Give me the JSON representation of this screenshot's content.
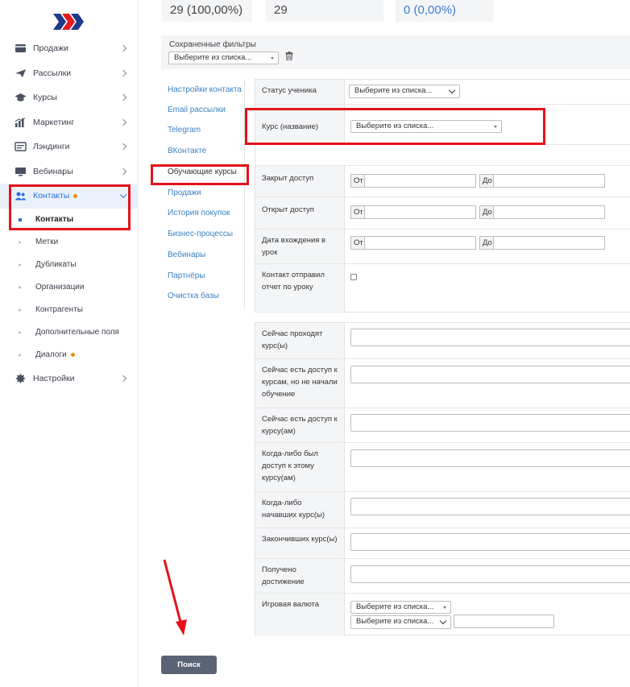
{
  "sidebar": {
    "logo_icon": "brand-chevrons-icon",
    "items": [
      {
        "label": "Продажи",
        "icon": "wallet-icon"
      },
      {
        "label": "Рассылки",
        "icon": "paper-plane-icon"
      },
      {
        "label": "Курсы",
        "icon": "graduation-cap-icon"
      },
      {
        "label": "Маркетинг",
        "icon": "bar-chart-icon"
      },
      {
        "label": "Лэндинги",
        "icon": "landing-page-icon"
      },
      {
        "label": "Вебинары",
        "icon": "monitor-icon"
      },
      {
        "label": "Контакты",
        "icon": "users-icon"
      }
    ],
    "contacts_sub": [
      {
        "label": "Контакты"
      },
      {
        "label": "Метки"
      },
      {
        "label": "Дубликаты"
      },
      {
        "label": "Организации"
      },
      {
        "label": "Контрагенты"
      },
      {
        "label": "Дополнительные поля"
      },
      {
        "label": "Диалоги"
      }
    ],
    "settings": {
      "label": "Настройки",
      "icon": "gear-icon"
    }
  },
  "stats": {
    "a": "29 (100,00%)",
    "b": "29",
    "c": "0 (0,00%)"
  },
  "saved_filters": {
    "label": "Сохраненные фильтры",
    "select_value": "Выберите из списка..."
  },
  "section_menu": [
    "Настройки контакта",
    "Email рассылки",
    "Telegram",
    "ВКонтакте",
    "Обучающие курсы",
    "Продажи",
    "История покупок",
    "Бизнес-процессы",
    "Вебинары",
    "Партнёры",
    "Очистка базы"
  ],
  "form": {
    "status_label": "Статус ученика",
    "status_value": "Выберите из списка...",
    "course_label": "Курс (название)",
    "course_value": "Выберите из списка...",
    "closed_access": "Закрыт доступ",
    "open_access": "Открыт доступ",
    "lesson_entry_date": "Дата вхождения в урок",
    "report_sent": "Контакт отправил отчет по уроку",
    "from": "От",
    "to": "До",
    "passing_now": "Сейчас проходят курс(ы)",
    "access_not_started": "Сейчас есть доступ к курсам, но не начали обучение",
    "access_now": "Сейчас есть доступ к курсу(ам)",
    "ever_had_access": "Когда-либо был доступ к этому курсу(ам)",
    "ever_started": "Когда-либо начавших курс(ы)",
    "finished": "Закончивших курс(ы)",
    "achievement": "Получено достижение",
    "currency": "Игровая валюта",
    "currency_select_1": "Выберите из списка...",
    "currency_select_2": "Выберите из списка..."
  },
  "search_button": "Поиск",
  "colors": {
    "accent_blue": "#2c6ed5",
    "link_blue": "#3b82c4",
    "annotation_red": "#e3121a",
    "notification_orange": "#ef8a13",
    "button_gray": "#5b6474"
  }
}
